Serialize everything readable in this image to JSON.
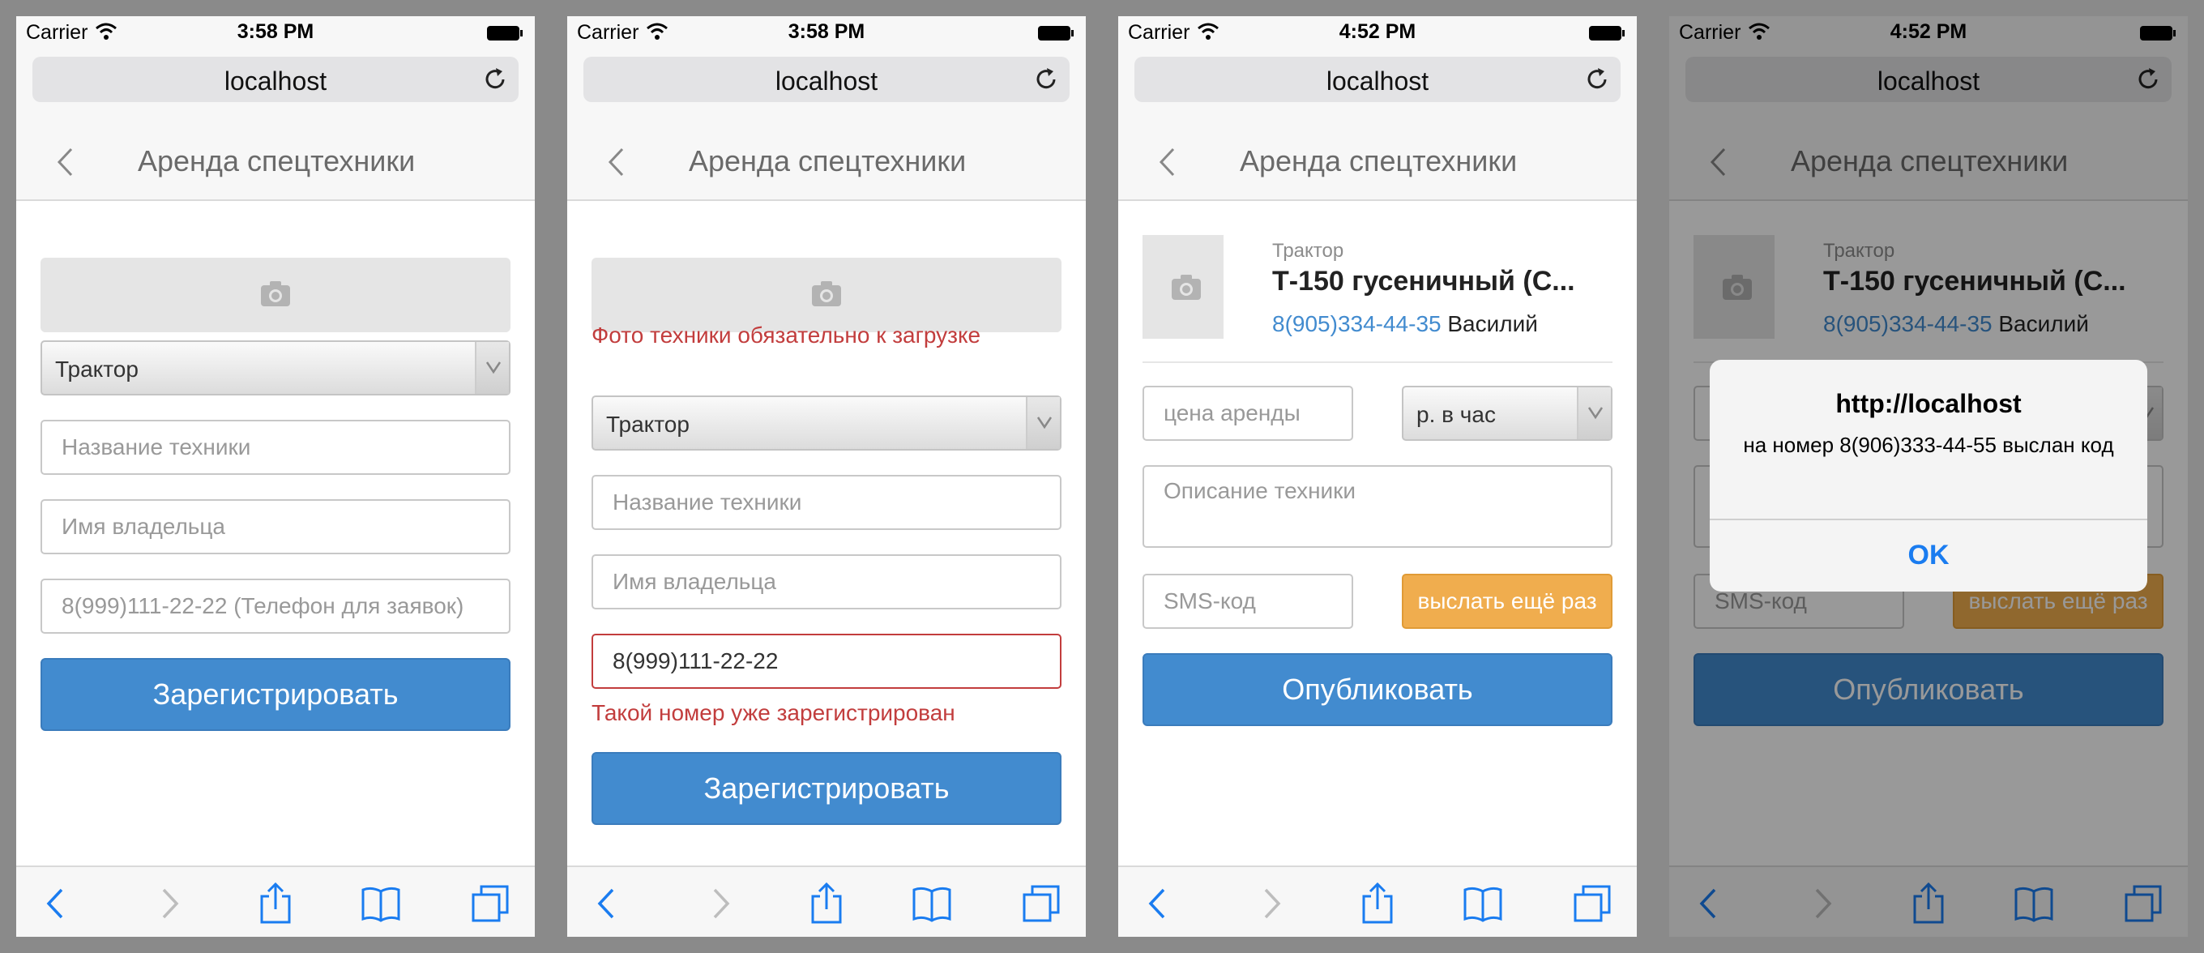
{
  "browser": {
    "carrier": "Carrier",
    "url": "localhost"
  },
  "screens": [
    {
      "time": "3:58 PM",
      "title": "Аренда спецтехники",
      "category_value": "Трактор",
      "name_placeholder": "Название техники",
      "owner_placeholder": "Имя владельца",
      "phone_placeholder": "8(999)111-22-22 (Телефон для заявок)",
      "register_label": "Зарегистрировать"
    },
    {
      "time": "3:58 PM",
      "title": "Аренда спецтехники",
      "photo_error": "Фото техники обязательно к загрузке",
      "category_value": "Трактор",
      "name_placeholder": "Название техники",
      "owner_placeholder": "Имя владельца",
      "phone_value": "8(999)111-22-22",
      "phone_error": "Такой номер уже зарегистрирован",
      "register_label": "Зарегистрировать"
    },
    {
      "time": "4:52 PM",
      "title": "Аренда спецтехники",
      "category": "Трактор",
      "equipment_name": "Т-150 гусеничный (С...",
      "phone": "8(905)334-44-35",
      "owner": "Василий",
      "price_placeholder": "цена аренды",
      "unit_value": "р. в час",
      "description_placeholder": "Описание техники",
      "sms_placeholder": "SMS-код",
      "resend_label": "выслать ещё раз",
      "publish_label": "Опубликовать"
    },
    {
      "time": "4:52 PM",
      "title": "Аренда спецтехники",
      "category": "Трактор",
      "equipment_name": "Т-150 гусеничный (С...",
      "phone": "8(905)334-44-35",
      "owner": "Василий",
      "sms_placeholder": "SMS-код",
      "resend_label": "выслать ещё раз",
      "publish_label": "Опубликовать",
      "alert": {
        "title": "http://localhost",
        "message": "на номер  8(906)333-44-55 выслан код",
        "ok_label": "OK"
      }
    }
  ],
  "colors": {
    "primary": "#428bcf",
    "error": "#c23d3d",
    "warning": "#f0ad4e",
    "ios_blue": "#1a7cf0"
  }
}
